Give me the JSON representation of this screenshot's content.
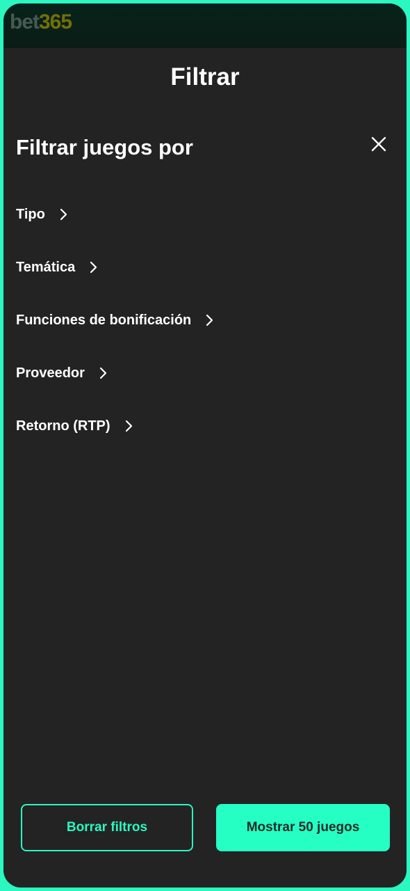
{
  "header": {
    "logo_part1": "bet",
    "logo_part2": "365",
    "title": "Filtrar"
  },
  "filters": {
    "heading": "Filtrar juegos por",
    "close_icon": "close-icon",
    "items": [
      {
        "label": "Tipo"
      },
      {
        "label": "Temática"
      },
      {
        "label": "Funciones de bonificación"
      },
      {
        "label": "Proveedor"
      },
      {
        "label": "Retorno (RTP)"
      }
    ]
  },
  "actions": {
    "clear_label": "Borrar filtros",
    "show_label": "Mostrar 50 juegos"
  },
  "colors": {
    "accent": "#2bf7c0",
    "background": "#232323",
    "text": "#ffffff"
  }
}
